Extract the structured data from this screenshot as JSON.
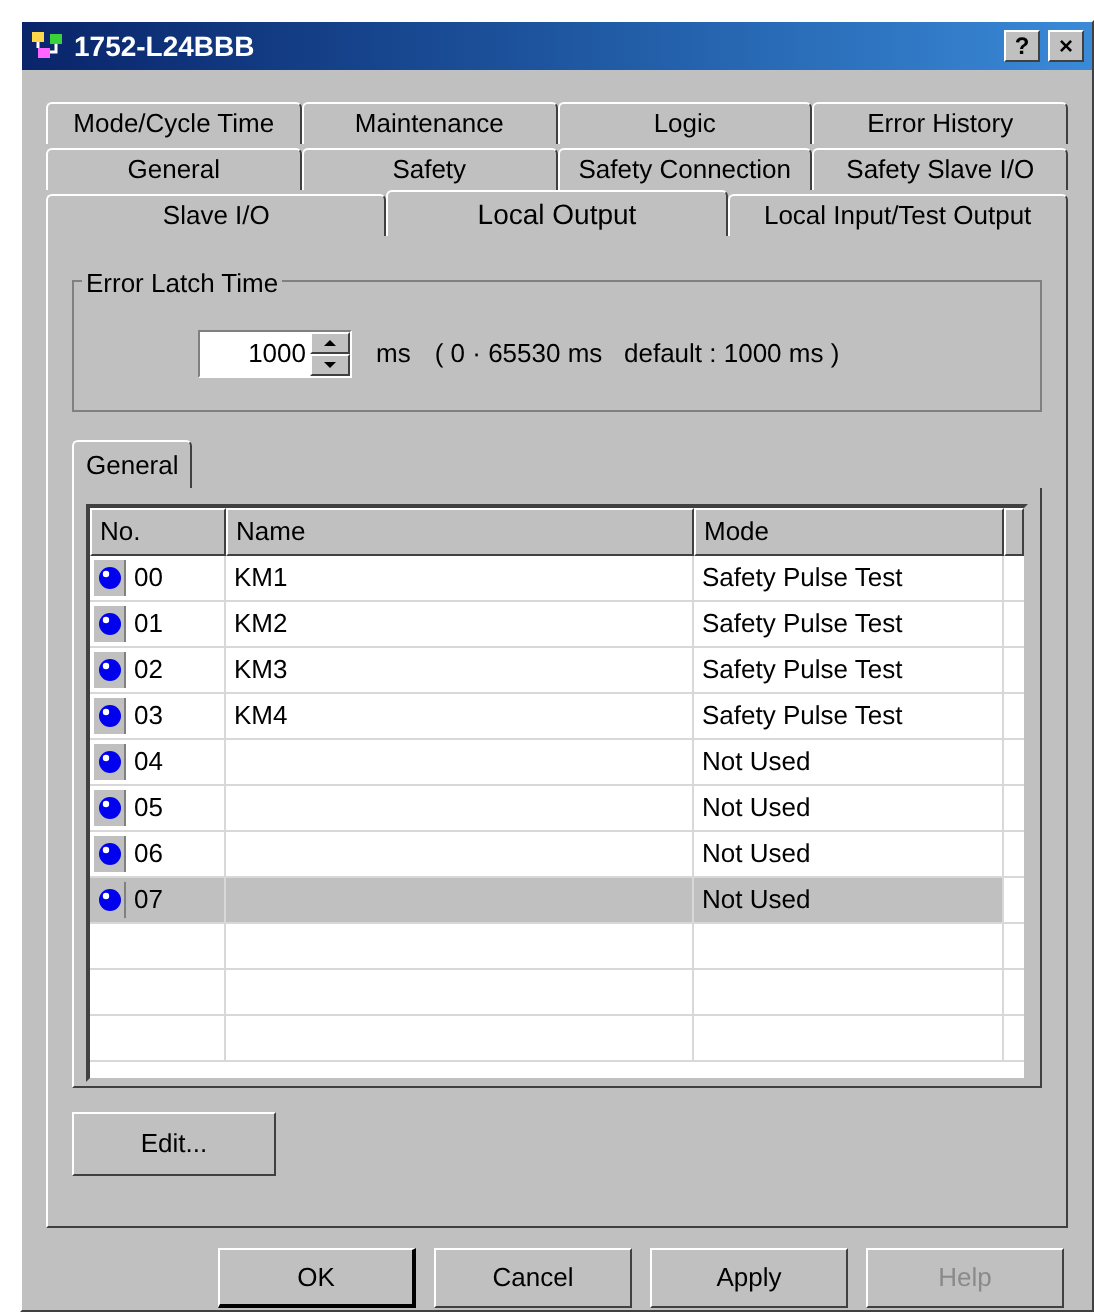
{
  "window": {
    "title": "1752-L24BBB",
    "buttons": [
      "?",
      "×"
    ]
  },
  "tab_rows": [
    [
      {
        "label": "Mode/Cycle Time",
        "selected": false
      },
      {
        "label": "Maintenance",
        "selected": false
      },
      {
        "label": "Logic",
        "selected": false
      },
      {
        "label": "Error History",
        "selected": false
      }
    ],
    [
      {
        "label": "General",
        "selected": false
      },
      {
        "label": "Safety",
        "selected": false
      },
      {
        "label": "Safety Connection",
        "selected": false
      },
      {
        "label": "Safety Slave I/O",
        "selected": false
      }
    ],
    [
      {
        "label": "Slave I/O",
        "selected": false
      },
      {
        "label": "Local Output",
        "selected": true
      },
      {
        "label": "Local Input/Test Output",
        "selected": false
      }
    ]
  ],
  "error_latch": {
    "title": "Error Latch Time",
    "value": "1000",
    "unit": "ms",
    "range": "( 0 · 65530 ms   default : 1000 ms )"
  },
  "inner_tab": {
    "label": "General",
    "selected": true
  },
  "table": {
    "columns": [
      "No.",
      "Name",
      "Mode"
    ],
    "rows": [
      {
        "no": "00",
        "name": "KM1",
        "mode": "Safety Pulse Test",
        "selected": false
      },
      {
        "no": "01",
        "name": "KM2",
        "mode": "Safety Pulse Test",
        "selected": false
      },
      {
        "no": "02",
        "name": "KM3",
        "mode": "Safety Pulse Test",
        "selected": false
      },
      {
        "no": "03",
        "name": "KM4",
        "mode": "Safety Pulse Test",
        "selected": false
      },
      {
        "no": "04",
        "name": "",
        "mode": "Not Used",
        "selected": false
      },
      {
        "no": "05",
        "name": "",
        "mode": "Not Used",
        "selected": false
      },
      {
        "no": "06",
        "name": "",
        "mode": "Not Used",
        "selected": false
      },
      {
        "no": "07",
        "name": "",
        "mode": "Not Used",
        "selected": true
      }
    ]
  },
  "edit_button": "Edit...",
  "buttons": [
    {
      "label": "OK",
      "disabled": false,
      "default": true
    },
    {
      "label": "Cancel",
      "disabled": false,
      "default": false
    },
    {
      "label": "Apply",
      "disabled": false,
      "default": false
    },
    {
      "label": "Help",
      "disabled": true,
      "default": false
    }
  ]
}
